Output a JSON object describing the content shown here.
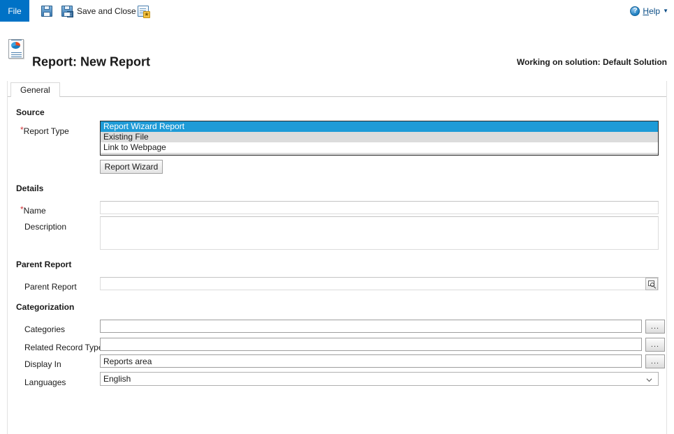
{
  "commandbar": {
    "file_label": "File",
    "save_label": "",
    "save_icon": "save-icon",
    "save_and_close_label": "Save and Close",
    "save_and_close_icon": "save-and-close-icon",
    "new_label": "",
    "new_icon": "new-record-icon",
    "help_label": "Help",
    "help_icon": "help-circle-icon",
    "help_caret": "▼"
  },
  "header": {
    "title": "Report: New Report",
    "icon": "report-document-icon",
    "solution_note": "Working on solution: Default Solution"
  },
  "form": {
    "tabs": [
      {
        "label": "General",
        "active": true
      }
    ],
    "sections": {
      "source": {
        "heading": "Source",
        "report_type": {
          "label": "Report Type",
          "required": true,
          "options": [
            "Report Wizard Report",
            "Existing File",
            "Link to Webpage"
          ],
          "selected": "Report Wizard Report"
        },
        "wizard_button": "Report Wizard"
      },
      "details": {
        "heading": "Details",
        "name": {
          "label": "Name",
          "required": true,
          "value": "",
          "placeholder": ""
        },
        "description": {
          "label": "Description",
          "required": false,
          "value": "",
          "placeholder": ""
        }
      },
      "parent_report": {
        "heading": "Parent Report",
        "parent_report": {
          "label": "Parent Report",
          "required": false,
          "value": "",
          "placeholder": "",
          "lookup_icon": "lookup-magnifier-icon"
        }
      },
      "categorization": {
        "heading": "Categorization",
        "categories": {
          "label": "Categories",
          "value": "",
          "button": "...",
          "button_icon": "ellipsis-icon"
        },
        "related_record_types": {
          "label": "Related Record Types",
          "value": "",
          "button": "...",
          "button_icon": "ellipsis-icon"
        },
        "display_in": {
          "label": "Display In",
          "value": "Reports area",
          "button": "...",
          "button_icon": "ellipsis-icon"
        },
        "languages": {
          "label": "Languages",
          "value": "English",
          "caret_icon": "chevron-down-icon"
        }
      }
    }
  },
  "colors": {
    "accent_blue": "#0072c6",
    "selection_blue": "#1e9bd7",
    "required_red": "#d13438",
    "link_blue": "#0a4d86",
    "listbox_bg": "#dcdcdc"
  }
}
